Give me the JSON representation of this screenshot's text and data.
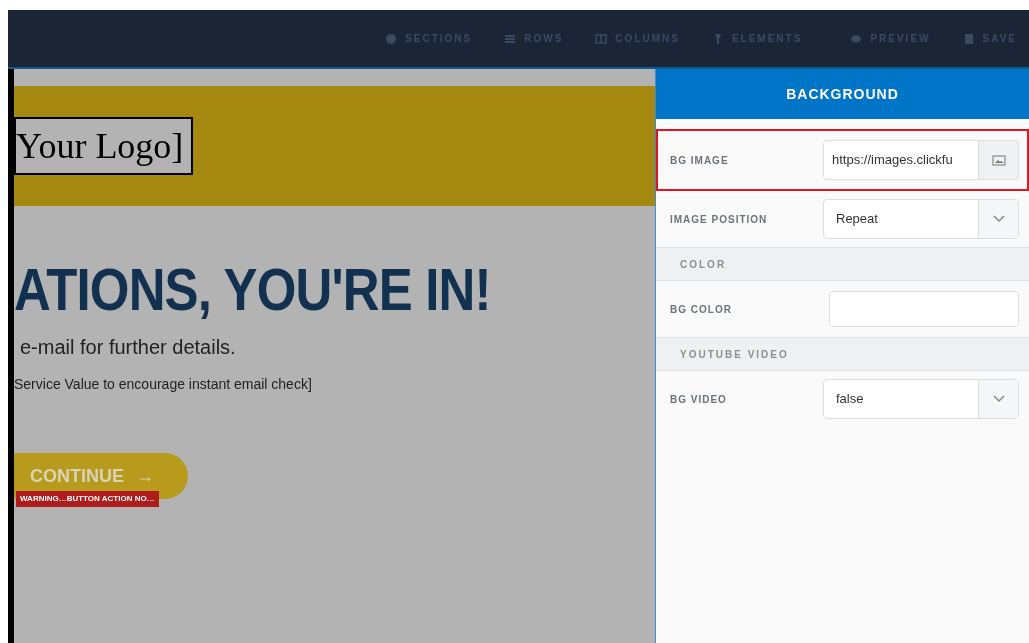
{
  "toolbar": {
    "items": [
      {
        "label": "SECTIONS"
      },
      {
        "label": "ROWS"
      },
      {
        "label": "COLUMNS"
      },
      {
        "label": "ELEMENTS"
      },
      {
        "label": "PREVIEW"
      },
      {
        "label": "SAVE"
      }
    ]
  },
  "canvas": {
    "logo": "Your Logo]",
    "headline": "ATIONS, YOU'RE IN!",
    "subheading": "e-mail for further details.",
    "body": "Service Value to encourage instant email check]",
    "button": {
      "label": "CONTINUE",
      "arrow": "→"
    },
    "warning": "WARNING…BUTTON ACTION NO…"
  },
  "panel": {
    "title": "BACKGROUND",
    "rows": [
      {
        "kind": "image",
        "label": "BG IMAGE",
        "value": "https://images.clickfu",
        "highlighted": true
      },
      {
        "kind": "select",
        "label": "IMAGE POSITION",
        "value": "Repeat",
        "highlighted": false
      },
      {
        "kind": "section",
        "label": "COLOR"
      },
      {
        "kind": "color",
        "label": "BG COLOR",
        "highlighted": false
      },
      {
        "kind": "section",
        "label": "YOUTUBE VIDEO"
      },
      {
        "kind": "select",
        "label": "BG VIDEO",
        "value": "false",
        "highlighted": false
      }
    ]
  }
}
